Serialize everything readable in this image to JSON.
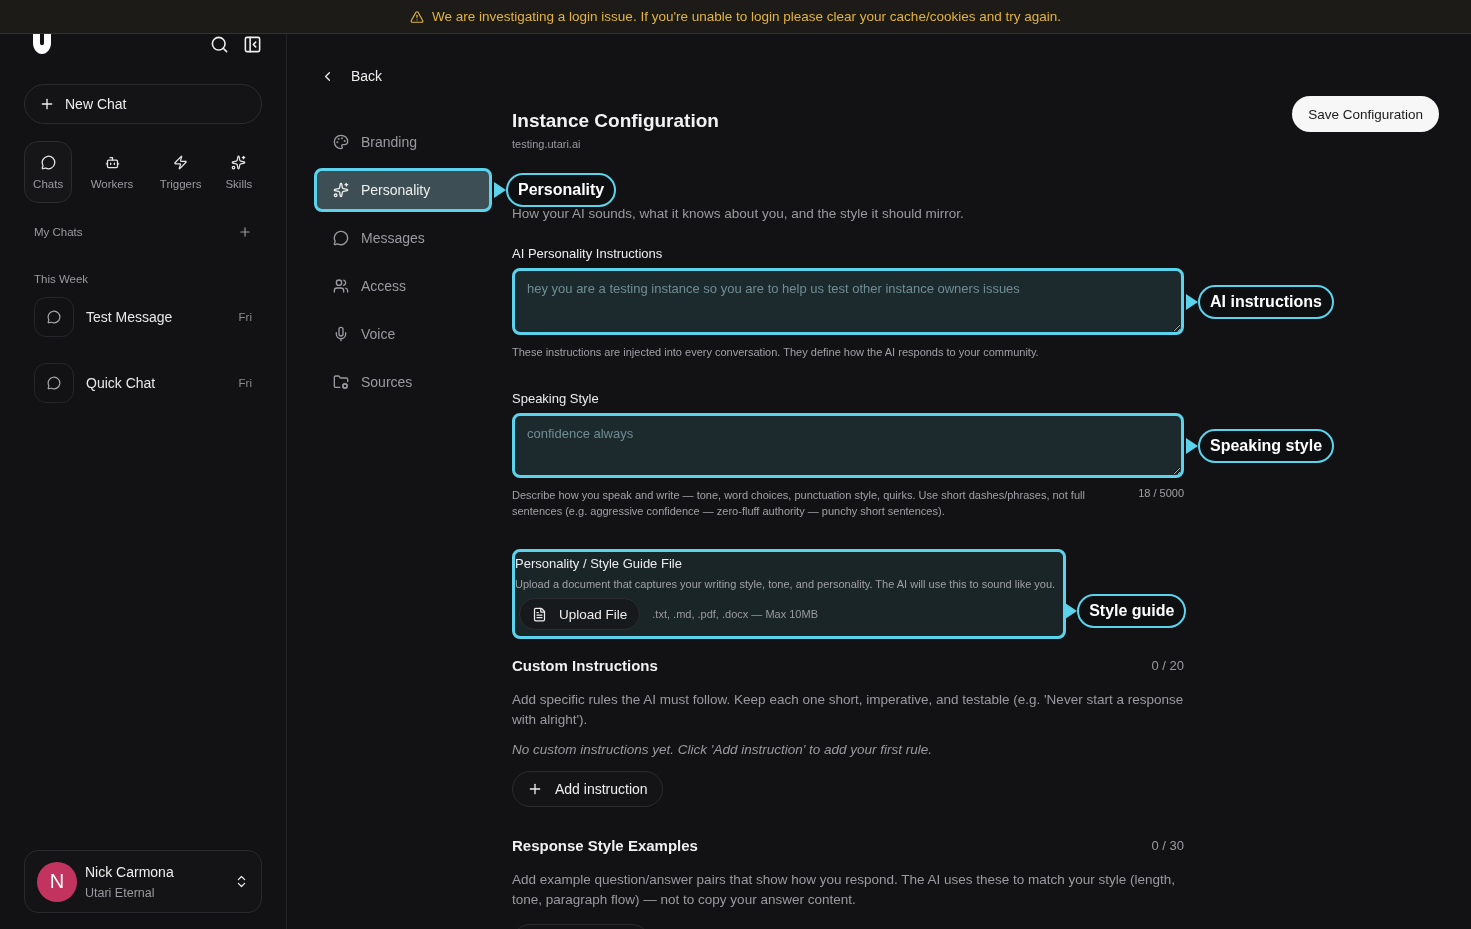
{
  "banner": {
    "text": "We are investigating a login issue. If you're unable to login please clear your cache/cookies and try again."
  },
  "sidebar": {
    "new_chat": "New Chat",
    "tabs": [
      {
        "label": "Chats",
        "selected": true
      },
      {
        "label": "Workers",
        "selected": false
      },
      {
        "label": "Triggers",
        "selected": false
      },
      {
        "label": "Skills",
        "selected": false
      }
    ],
    "my_chats": "My Chats",
    "groups": [
      {
        "title": "This Week",
        "chats": [
          {
            "title": "Test Message",
            "day": "Fri"
          },
          {
            "title": "Quick Chat",
            "day": "Fri"
          }
        ]
      }
    ],
    "user": {
      "initial": "N",
      "name": "Nick Carmona",
      "org": "Utari Eternal",
      "color": "#c2345f"
    }
  },
  "back": "Back",
  "settings_nav": [
    {
      "label": "Branding",
      "selected": false
    },
    {
      "label": "Personality",
      "selected": true,
      "callout": "Personality"
    },
    {
      "label": "Messages",
      "selected": false
    },
    {
      "label": "Access",
      "selected": false
    },
    {
      "label": "Voice",
      "selected": false
    },
    {
      "label": "Sources",
      "selected": false
    }
  ],
  "page": {
    "title": "Instance Configuration",
    "subtitle": "testing.utari.ai",
    "save": "Save Configuration",
    "intro": "How your AI sounds, what it knows about you, and the style it should mirror."
  },
  "fields": [
    {
      "label": "AI Personality Instructions",
      "value": "hey you are a testing instance so you are to help us test other instance owners issues",
      "help": "These instructions are injected into every conversation. They define how the AI responds to your community.",
      "callout": "AI instructions"
    },
    {
      "label": "Speaking Style",
      "value": "confidence always",
      "help": "Describe how you speak and write — tone, word choices, punctuation style, quirks. Use short dashes/phrases, not full sentences (e.g. aggressive confidence — zero-fluff authority — punchy short sentences).",
      "counter": "18 / 5000",
      "callout": "Speaking style"
    }
  ],
  "style_guide": {
    "label": "Personality / Style Guide File",
    "description": "Upload a document that captures your writing style, tone, and personality. The AI will use this to sound like you.",
    "button": "Upload File",
    "formats": ".txt, .md, .pdf, .docx — Max 10MB",
    "callout": "Style guide"
  },
  "custom_instructions": {
    "title": "Custom Instructions",
    "count": "0 / 20",
    "description": "Add specific rules the AI must follow. Keep each one short, imperative, and testable (e.g. 'Never start a response with alright').",
    "empty": "No custom instructions yet. Click 'Add instruction' to add your first rule.",
    "button": "Add instruction"
  },
  "response_examples": {
    "title": "Response Style Examples",
    "count": "0 / 30",
    "description": "Add example question/answer pairs that show how you respond. The AI uses these to match your style (length, tone, paragraph flow) — not to copy your answer content."
  }
}
